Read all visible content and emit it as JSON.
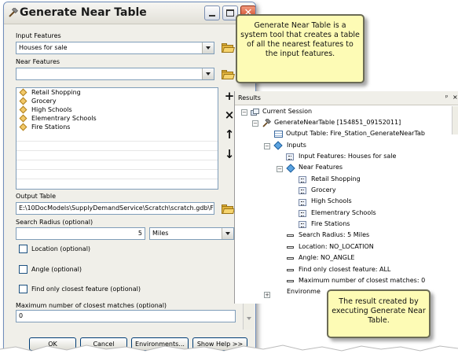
{
  "tool": {
    "title": "Generate Near Table",
    "input_features_label": "Input Features",
    "input_features_value": "Houses for sale",
    "near_features_label": "Near Features",
    "near_features_value": "",
    "near_features_list": [
      "Retail Shopping",
      "Grocery",
      "High Schools",
      "Elementrary Schools",
      "Fire Stations"
    ],
    "output_table_label": "Output Table",
    "output_table_value": "E:\\10DocModels\\SupplyDemandService\\Scratch\\scratch.gdb\\Fir",
    "search_radius_label": "Search Radius (optional)",
    "search_radius_value": "5",
    "search_radius_unit": "Miles",
    "location_label": "Location (optional)",
    "angle_label": "Angle (optional)",
    "closest_label": "Find only closest feature (optional)",
    "max_matches_label": "Maximum number of closest matches (optional)",
    "max_matches_value": "0",
    "buttons": {
      "ok": "OK",
      "cancel": "Cancel",
      "environments": "Environments...",
      "show_help": "Show Help >>"
    }
  },
  "results": {
    "title": "Results",
    "session": "Current Session",
    "tool_node": "GenerateNearTable [154851_09152011]",
    "output_table": "Output Table: Fire_Station_GenerateNearTab",
    "inputs": "Inputs",
    "input_features": "Input Features: Houses for sale",
    "near_features": "Near Features",
    "near_items": [
      "Retail Shopping",
      "Grocery",
      "High Schools",
      "Elementrary Schools",
      "Fire Stations"
    ],
    "search_radius": "Search Radius: 5 Miles",
    "location": "Location: NO_LOCATION",
    "angle": "Angle: NO_ANGLE",
    "closest": "Find only closest feature: ALL",
    "max_matches": "Maximum number of closest matches: 0",
    "environments": "Environme"
  },
  "callouts": {
    "top": "Generate Near Table is a system tool that creates a table of all the nearest features to the input features.",
    "bottom": "The result created by executing Generate Near Table."
  }
}
